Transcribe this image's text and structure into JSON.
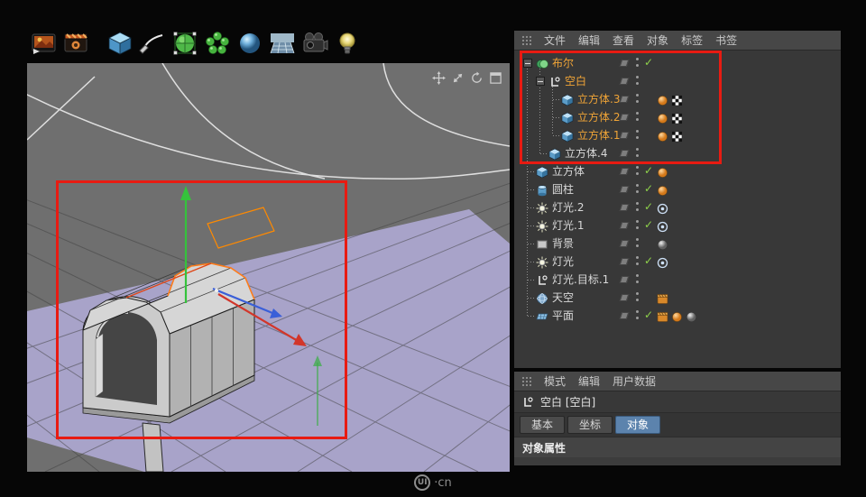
{
  "toolbar": {
    "icons": [
      {
        "name": "render-view"
      },
      {
        "name": "render-settings"
      },
      {
        "name": "cube-primitive"
      },
      {
        "name": "freehand-spline"
      },
      {
        "name": "subdivision-surface"
      },
      {
        "name": "array-generator"
      },
      {
        "name": "metaball"
      },
      {
        "name": "floor-environment"
      },
      {
        "name": "camera"
      },
      {
        "name": "light"
      }
    ]
  },
  "viewport": {
    "nav_icons": [
      "pan",
      "zoom",
      "rotate",
      "maximize"
    ]
  },
  "object_manager": {
    "menu": [
      "文件",
      "编辑",
      "查看",
      "对象",
      "标签",
      "书签"
    ],
    "objects": [
      {
        "name": "布尔",
        "level": 0,
        "icon": "boole",
        "name_color": "orange",
        "expander": true,
        "check": true,
        "tags": []
      },
      {
        "name": "空白",
        "level": 1,
        "icon": "null",
        "name_color": "orange",
        "expander": true,
        "check": false,
        "tags": []
      },
      {
        "name": "立方体.3",
        "level": 2,
        "icon": "cube",
        "name_color": "orange",
        "expander": false,
        "check": false,
        "tags": [
          "phong",
          "texture"
        ]
      },
      {
        "name": "立方体.2",
        "level": 2,
        "icon": "cube",
        "name_color": "orange",
        "expander": false,
        "check": false,
        "tags": [
          "phong",
          "texture"
        ]
      },
      {
        "name": "立方体.1",
        "level": 2,
        "icon": "cube",
        "name_color": "orange",
        "expander": false,
        "check": false,
        "tags": [
          "phong",
          "texture"
        ]
      },
      {
        "name": "立方体.4",
        "level": 1,
        "icon": "cube",
        "name_color": "white",
        "expander": false,
        "check": false,
        "tags": []
      },
      {
        "name": "立方体",
        "level": 0,
        "icon": "cube",
        "name_color": "white",
        "expander": false,
        "check": true,
        "tags": [
          "phong"
        ]
      },
      {
        "name": "圆柱",
        "level": 0,
        "icon": "cylinder",
        "name_color": "white",
        "expander": false,
        "check": true,
        "tags": [
          "phong"
        ]
      },
      {
        "name": "灯光.2",
        "level": 0,
        "icon": "light",
        "name_color": "white",
        "expander": false,
        "check": true,
        "tags": [
          "target"
        ]
      },
      {
        "name": "灯光.1",
        "level": 0,
        "icon": "light",
        "name_color": "white",
        "expander": false,
        "check": true,
        "tags": [
          "target"
        ]
      },
      {
        "name": "背景",
        "level": 0,
        "icon": "background",
        "name_color": "white",
        "expander": false,
        "check": false,
        "tags": [
          "material-sphere"
        ]
      },
      {
        "name": "灯光",
        "level": 0,
        "icon": "light",
        "name_color": "white",
        "expander": false,
        "check": true,
        "tags": [
          "target"
        ]
      },
      {
        "name": "灯光.目标.1",
        "level": 0,
        "icon": "null",
        "name_color": "white",
        "expander": false,
        "check": false,
        "tags": []
      },
      {
        "name": "天空",
        "level": 0,
        "icon": "sky",
        "name_color": "white",
        "expander": false,
        "check": false,
        "tags": [
          "compositing"
        ]
      },
      {
        "name": "平面",
        "level": 0,
        "icon": "plane",
        "name_color": "white",
        "expander": false,
        "check": true,
        "tags": [
          "compositing",
          "phong",
          "material-sphere"
        ]
      }
    ]
  },
  "attribute_manager": {
    "menu": [
      "模式",
      "编辑",
      "用户数据"
    ],
    "title": "空白 [空白]",
    "tabs": [
      {
        "label": "基本",
        "active": false
      },
      {
        "label": "坐标",
        "active": false
      },
      {
        "label": "对象",
        "active": true
      }
    ],
    "section": "对象属性"
  },
  "watermark": {
    "logo": "UI",
    "text": "·cn"
  },
  "colors": {
    "selected_orange": "#f0a437",
    "normal_text": "#d9d9d9",
    "annotation_red": "#e81b12",
    "tab_active_blue": "#5c83ad",
    "ground_plane": "#a8a3c9"
  }
}
